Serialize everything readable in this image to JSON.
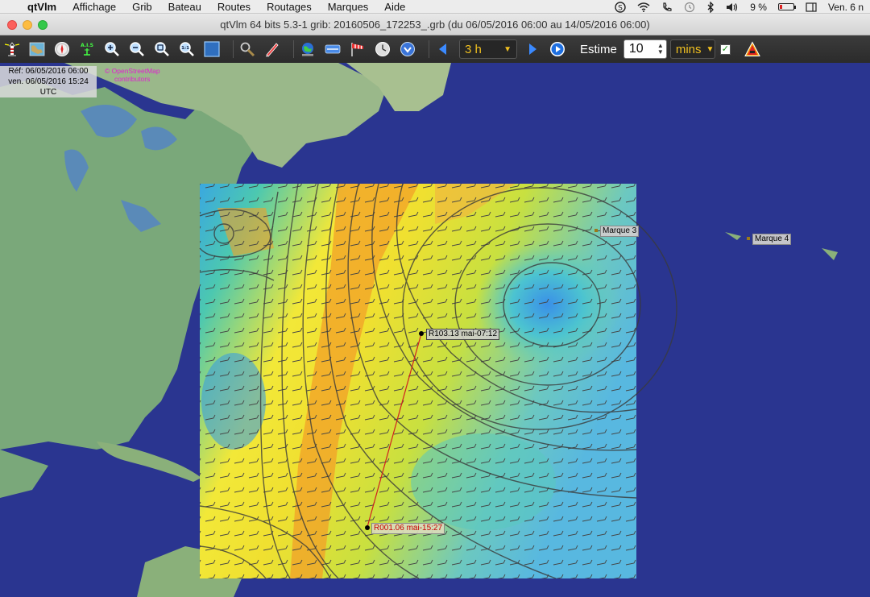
{
  "menubar": {
    "app_name": "qtVlm",
    "items": [
      "Affichage",
      "Grib",
      "Bateau",
      "Routes",
      "Routages",
      "Marques",
      "Aide"
    ],
    "battery": "9 %",
    "clock": "Ven. 6 n"
  },
  "window": {
    "title": "qtVlm 64 bits 5.3-1 grib: 20160506_172253_.grb (du 06/05/2016 06:00 au 14/05/2016 06:00)"
  },
  "toolbar": {
    "ais_label": "A.I.S",
    "zoom_11": "1:1",
    "step_value": "3 h",
    "estime_label": "Estime",
    "estime_value": "10",
    "unit_value": "mins",
    "checkbox_checked": true
  },
  "map": {
    "info": {
      "ref": "Réf: 06/05/2016 06:00",
      "current": "ven. 06/05/2016 15:24",
      "tz": "UTC"
    },
    "osm_line1": "© OpenStreetMap",
    "osm_line2": "contributors",
    "marks": [
      {
        "label": "Marque 3"
      },
      {
        "label": "Marque 4"
      }
    ],
    "route_points": [
      {
        "label": "R103.13 mai-07:12"
      },
      {
        "label": "R001.06 mai-15:27"
      }
    ],
    "colors": {
      "ocean": "#2a3590",
      "land": "#7aa87a",
      "wind_low": "#3aa0e8",
      "wind_mid": "#f0e030",
      "wind_high": "#f09a20",
      "route": "#d02020"
    }
  }
}
